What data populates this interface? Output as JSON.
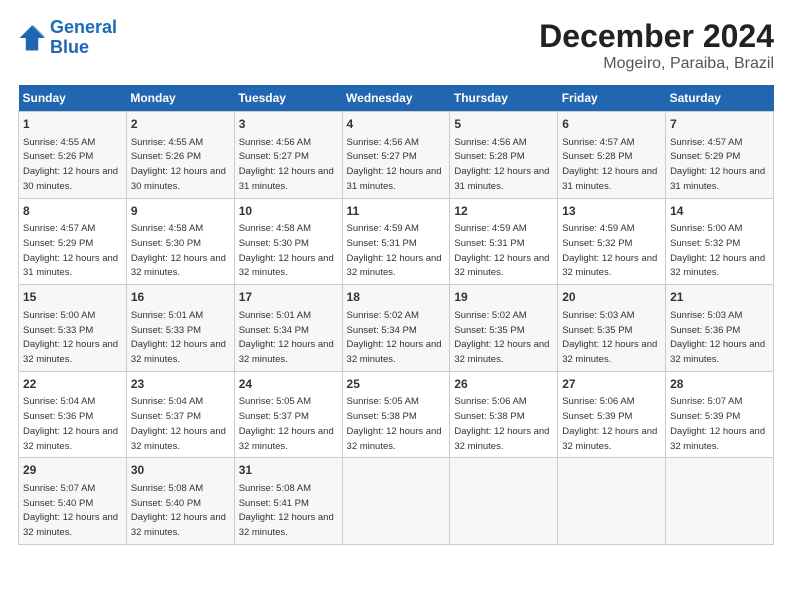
{
  "logo": {
    "line1": "General",
    "line2": "Blue"
  },
  "title": "December 2024",
  "location": "Mogeiro, Paraiba, Brazil",
  "days_of_week": [
    "Sunday",
    "Monday",
    "Tuesday",
    "Wednesday",
    "Thursday",
    "Friday",
    "Saturday"
  ],
  "weeks": [
    [
      {
        "day": "1",
        "sunrise": "4:55 AM",
        "sunset": "5:26 PM",
        "daylight": "12 hours and 30 minutes."
      },
      {
        "day": "2",
        "sunrise": "4:55 AM",
        "sunset": "5:26 PM",
        "daylight": "12 hours and 30 minutes."
      },
      {
        "day": "3",
        "sunrise": "4:56 AM",
        "sunset": "5:27 PM",
        "daylight": "12 hours and 31 minutes."
      },
      {
        "day": "4",
        "sunrise": "4:56 AM",
        "sunset": "5:27 PM",
        "daylight": "12 hours and 31 minutes."
      },
      {
        "day": "5",
        "sunrise": "4:56 AM",
        "sunset": "5:28 PM",
        "daylight": "12 hours and 31 minutes."
      },
      {
        "day": "6",
        "sunrise": "4:57 AM",
        "sunset": "5:28 PM",
        "daylight": "12 hours and 31 minutes."
      },
      {
        "day": "7",
        "sunrise": "4:57 AM",
        "sunset": "5:29 PM",
        "daylight": "12 hours and 31 minutes."
      }
    ],
    [
      {
        "day": "8",
        "sunrise": "4:57 AM",
        "sunset": "5:29 PM",
        "daylight": "12 hours and 31 minutes."
      },
      {
        "day": "9",
        "sunrise": "4:58 AM",
        "sunset": "5:30 PM",
        "daylight": "12 hours and 32 minutes."
      },
      {
        "day": "10",
        "sunrise": "4:58 AM",
        "sunset": "5:30 PM",
        "daylight": "12 hours and 32 minutes."
      },
      {
        "day": "11",
        "sunrise": "4:59 AM",
        "sunset": "5:31 PM",
        "daylight": "12 hours and 32 minutes."
      },
      {
        "day": "12",
        "sunrise": "4:59 AM",
        "sunset": "5:31 PM",
        "daylight": "12 hours and 32 minutes."
      },
      {
        "day": "13",
        "sunrise": "4:59 AM",
        "sunset": "5:32 PM",
        "daylight": "12 hours and 32 minutes."
      },
      {
        "day": "14",
        "sunrise": "5:00 AM",
        "sunset": "5:32 PM",
        "daylight": "12 hours and 32 minutes."
      }
    ],
    [
      {
        "day": "15",
        "sunrise": "5:00 AM",
        "sunset": "5:33 PM",
        "daylight": "12 hours and 32 minutes."
      },
      {
        "day": "16",
        "sunrise": "5:01 AM",
        "sunset": "5:33 PM",
        "daylight": "12 hours and 32 minutes."
      },
      {
        "day": "17",
        "sunrise": "5:01 AM",
        "sunset": "5:34 PM",
        "daylight": "12 hours and 32 minutes."
      },
      {
        "day": "18",
        "sunrise": "5:02 AM",
        "sunset": "5:34 PM",
        "daylight": "12 hours and 32 minutes."
      },
      {
        "day": "19",
        "sunrise": "5:02 AM",
        "sunset": "5:35 PM",
        "daylight": "12 hours and 32 minutes."
      },
      {
        "day": "20",
        "sunrise": "5:03 AM",
        "sunset": "5:35 PM",
        "daylight": "12 hours and 32 minutes."
      },
      {
        "day": "21",
        "sunrise": "5:03 AM",
        "sunset": "5:36 PM",
        "daylight": "12 hours and 32 minutes."
      }
    ],
    [
      {
        "day": "22",
        "sunrise": "5:04 AM",
        "sunset": "5:36 PM",
        "daylight": "12 hours and 32 minutes."
      },
      {
        "day": "23",
        "sunrise": "5:04 AM",
        "sunset": "5:37 PM",
        "daylight": "12 hours and 32 minutes."
      },
      {
        "day": "24",
        "sunrise": "5:05 AM",
        "sunset": "5:37 PM",
        "daylight": "12 hours and 32 minutes."
      },
      {
        "day": "25",
        "sunrise": "5:05 AM",
        "sunset": "5:38 PM",
        "daylight": "12 hours and 32 minutes."
      },
      {
        "day": "26",
        "sunrise": "5:06 AM",
        "sunset": "5:38 PM",
        "daylight": "12 hours and 32 minutes."
      },
      {
        "day": "27",
        "sunrise": "5:06 AM",
        "sunset": "5:39 PM",
        "daylight": "12 hours and 32 minutes."
      },
      {
        "day": "28",
        "sunrise": "5:07 AM",
        "sunset": "5:39 PM",
        "daylight": "12 hours and 32 minutes."
      }
    ],
    [
      {
        "day": "29",
        "sunrise": "5:07 AM",
        "sunset": "5:40 PM",
        "daylight": "12 hours and 32 minutes."
      },
      {
        "day": "30",
        "sunrise": "5:08 AM",
        "sunset": "5:40 PM",
        "daylight": "12 hours and 32 minutes."
      },
      {
        "day": "31",
        "sunrise": "5:08 AM",
        "sunset": "5:41 PM",
        "daylight": "12 hours and 32 minutes."
      },
      null,
      null,
      null,
      null
    ]
  ],
  "labels": {
    "sunrise_prefix": "Sunrise: ",
    "sunset_prefix": "Sunset: ",
    "daylight_prefix": "Daylight: "
  }
}
